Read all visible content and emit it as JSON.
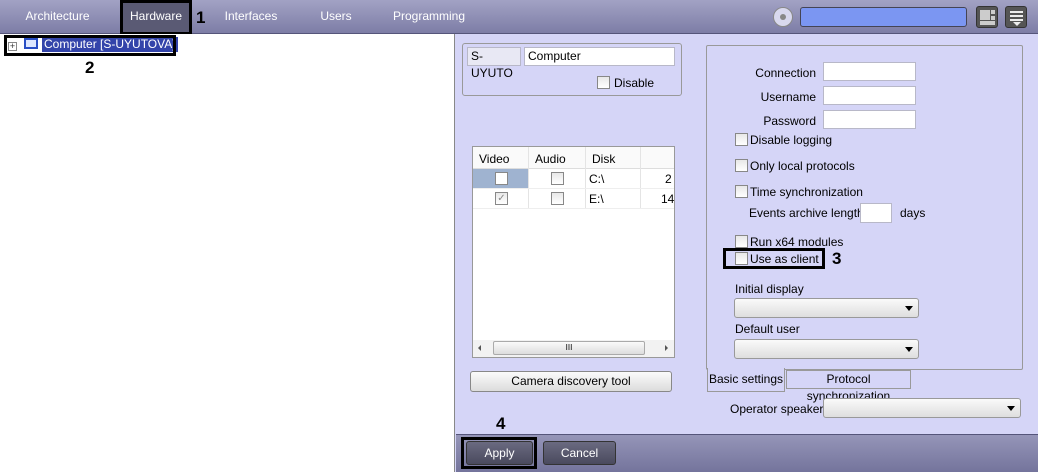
{
  "topbar": {
    "tabs": [
      {
        "label": "Architecture",
        "active": false
      },
      {
        "label": "Hardware",
        "active": true
      },
      {
        "label": "Interfaces",
        "active": false
      },
      {
        "label": "Users",
        "active": false
      },
      {
        "label": "Programming",
        "active": false
      }
    ],
    "search_value": "",
    "icons": [
      "settings-hex-icon",
      "layout-grid-icon",
      "menu-list-icon"
    ]
  },
  "tree": {
    "root_label": "Computer [S-UYUTOVA]"
  },
  "annotations": [
    "1",
    "2",
    "3",
    "4"
  ],
  "object": {
    "id": "S-UYUTO",
    "name": "Computer",
    "disable_label": "Disable",
    "disable_checked": false
  },
  "disk_table": {
    "headers": [
      "Video",
      "Audio",
      "Disk",
      ""
    ],
    "rows": [
      {
        "video": false,
        "audio": false,
        "disk": "C:\\",
        "extra": "2"
      },
      {
        "video": true,
        "audio": false,
        "disk": "E:\\",
        "extra": "14"
      }
    ],
    "scroll_grip": "III"
  },
  "camera_discovery_label": "Camera discovery tool",
  "settings": {
    "connection_label": "Connection",
    "connection_value": "",
    "username_label": "Username",
    "username_value": "",
    "password_label": "Password",
    "password_value": "",
    "disable_logging": "Disable logging",
    "only_local": "Only local protocols",
    "time_sync": "Time synchronization",
    "events_archive_label": "Events archive length",
    "events_archive_value": "",
    "days_label": "days",
    "run_x64": "Run x64 modules",
    "use_as_client": "Use as client",
    "initial_display_label": "Initial display",
    "initial_display_value": "",
    "default_user_label": "Default user",
    "default_user_value": ""
  },
  "settings_tabs": [
    {
      "label": "Basic settings",
      "active": true
    },
    {
      "label": "Protocol synchronization",
      "active": false
    }
  ],
  "operator_speaker_label": "Operator speaker:",
  "operator_speaker_value": "",
  "footer": {
    "apply": "Apply",
    "cancel": "Cancel"
  },
  "colors": {
    "panel_bg": "#d5d5f7",
    "search_field": "#7b96f2",
    "active_tab": "#5a5a74"
  }
}
